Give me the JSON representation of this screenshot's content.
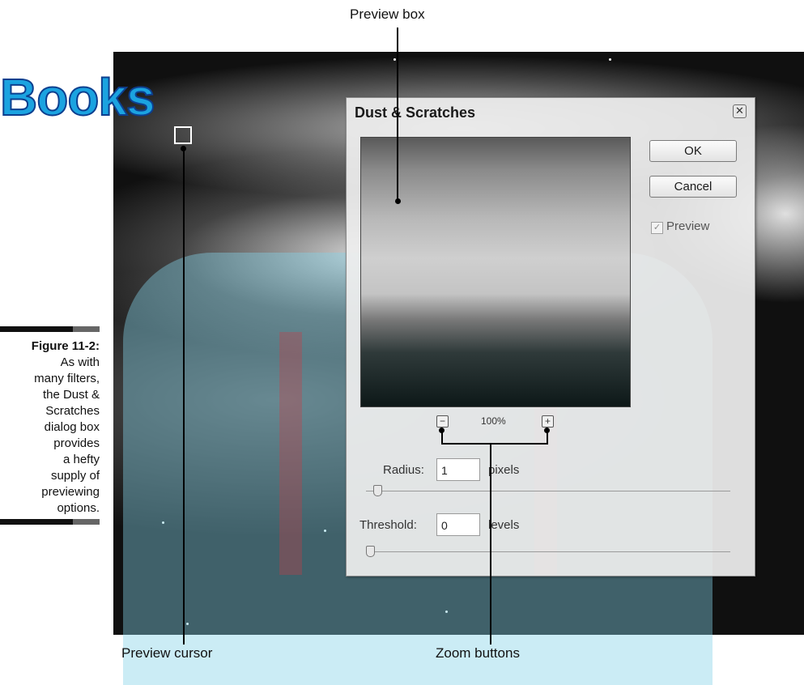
{
  "watermark": {
    "text": "Books"
  },
  "callouts": {
    "preview_box": "Preview box",
    "preview_cursor": "Preview cursor",
    "zoom_buttons": "Zoom buttons"
  },
  "figure_caption": {
    "label": "Figure 11-2:",
    "text_lines": [
      "As with",
      "many filters,",
      "the Dust &",
      "Scratches",
      "dialog box",
      "provides",
      "a hefty",
      "supply of",
      "previewing",
      "options."
    ]
  },
  "dialog": {
    "title": "Dust & Scratches",
    "close_icon": "close-icon",
    "ok_label": "OK",
    "cancel_label": "Cancel",
    "preview_checkbox": {
      "label": "Preview",
      "checked": true
    },
    "zoom": {
      "minus": "−",
      "level": "100%",
      "plus": "+"
    },
    "radius": {
      "label": "Radius:",
      "value": "1",
      "unit": "pixels",
      "slider_fraction": 0.02
    },
    "threshold": {
      "label": "Threshold:",
      "value": "0",
      "unit": "levels",
      "slider_fraction": 0.0
    }
  }
}
